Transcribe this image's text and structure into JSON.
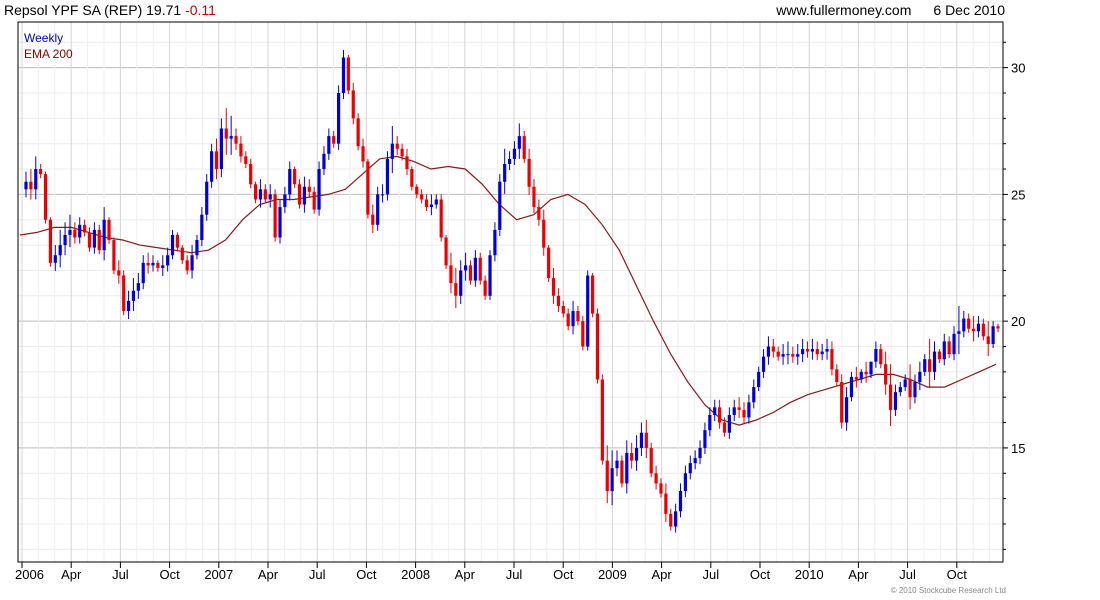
{
  "header": {
    "name": "Repsol YPF SA (REP)",
    "price": "19.71",
    "change": "-0.11",
    "site": "www.fullermoney.com",
    "date": "6 Dec 2010"
  },
  "legend": {
    "series1": "Weekly",
    "series2": "EMA 200"
  },
  "copyright": "© 2010 Stockcube Research Ltd",
  "colors": {
    "up": "#0000dd",
    "down": "#ee0000",
    "ema": "#8b1a1a",
    "grid": "#d8d8d8",
    "frame": "#000000"
  },
  "chart_data": {
    "type": "candlestick",
    "frequency": "weekly",
    "x_tick_labels": [
      "2006",
      "Apr",
      "Jul",
      "Oct",
      "2007",
      "Apr",
      "Jul",
      "Oct",
      "2008",
      "Apr",
      "Jul",
      "Oct",
      "2009",
      "Apr",
      "Jul",
      "Oct",
      "2010",
      "Apr",
      "Jul",
      "Oct"
    ],
    "y_tick_labels": [
      "15",
      "20",
      "25",
      "30"
    ],
    "ylim": [
      10.5,
      31.8
    ],
    "xlim": [
      "2006-01",
      "2010-12"
    ],
    "grid": true,
    "y_axis_side": "right",
    "legend_position": "top-left",
    "series": [
      {
        "name": "Weekly",
        "kind": "candlestick",
        "close": [
          25.5,
          25.2,
          26.0,
          25.8,
          24.0,
          22.3,
          22.6,
          23.0,
          23.4,
          23.6,
          23.3,
          23.8,
          23.5,
          22.9,
          23.6,
          22.8,
          24.0,
          23.2,
          22.0,
          21.8,
          20.4,
          20.8,
          21.2,
          21.5,
          22.3,
          22.2,
          22.3,
          22.1,
          22.2,
          22.6,
          23.4,
          22.9,
          22.4,
          22.0,
          22.6,
          23.2,
          24.2,
          25.5,
          26.7,
          26.0,
          27.6,
          27.2,
          27.3,
          27.0,
          26.5,
          26.2,
          25.4,
          24.8,
          25.2,
          24.8,
          25.0,
          23.3,
          24.5,
          25.0,
          26.0,
          25.4,
          24.6,
          25.3,
          25.1,
          24.4,
          26.0,
          26.6,
          27.3,
          27.0,
          29.0,
          30.4,
          29.1,
          28.0,
          26.9,
          26.3,
          24.2,
          23.8,
          25.0,
          25.0,
          26.4,
          27.0,
          26.8,
          26.5,
          26.0,
          25.3,
          25.0,
          24.8,
          24.5,
          24.6,
          24.8,
          23.3,
          22.2,
          21.5,
          21.0,
          22.0,
          22.2,
          21.6,
          22.5,
          21.6,
          21.0,
          22.6,
          23.6,
          25.5,
          26.2,
          26.4,
          26.8,
          27.3,
          26.4,
          25.3,
          24.5,
          24.0,
          22.9,
          21.7,
          21.0,
          20.6,
          20.3,
          19.8,
          20.4,
          20.0,
          19.0,
          21.8,
          20.3,
          17.7,
          14.5,
          13.3,
          14.2,
          14.5,
          13.6,
          14.8,
          14.5,
          15.0,
          15.6,
          15.0,
          14.0,
          13.6,
          13.2,
          12.4,
          11.9,
          12.5,
          13.3,
          14.0,
          14.4,
          14.6,
          15.0,
          15.7,
          16.3,
          16.6,
          16.0,
          15.6,
          16.3,
          16.6,
          16.5,
          16.2,
          16.8,
          17.4,
          18.0,
          18.6,
          19.0,
          18.8,
          18.6,
          18.7,
          18.7,
          18.6,
          18.7,
          18.9,
          18.8,
          18.9,
          18.7,
          18.8,
          18.9,
          18.1,
          17.6,
          16.0,
          17.0,
          17.8,
          17.7,
          18.0,
          17.9,
          18.4,
          18.9,
          18.3,
          17.5,
          16.5,
          17.2,
          17.4,
          17.7,
          17.0,
          17.6,
          18.0,
          18.5,
          18.0,
          18.8,
          18.5,
          19.2,
          18.7,
          19.5,
          19.6,
          20.1,
          19.7,
          19.6,
          19.9,
          19.4,
          19.1,
          19.8,
          19.71
        ],
        "high": [
          25.9,
          26.0,
          26.5,
          26.2,
          25.9,
          24.1,
          23.0,
          23.6,
          23.9,
          24.2,
          23.9,
          24.1,
          24.0,
          23.7,
          23.9,
          23.8,
          24.5,
          24.1,
          23.3,
          22.4,
          22.0,
          21.2,
          21.7,
          21.9,
          22.6,
          22.7,
          22.6,
          22.4,
          22.6,
          22.9,
          23.6,
          23.5,
          23.0,
          22.6,
          23.0,
          23.4,
          24.5,
          25.8,
          27.0,
          27.2,
          28.0,
          28.4,
          28.1,
          27.6,
          27.3,
          26.7,
          26.4,
          25.5,
          25.6,
          25.4,
          25.4,
          25.2,
          24.8,
          25.3,
          26.3,
          26.1,
          25.6,
          25.7,
          25.6,
          25.3,
          26.3,
          26.9,
          27.6,
          27.5,
          29.3,
          30.7,
          30.5,
          29.4,
          28.2,
          27.2,
          26.4,
          24.6,
          25.3,
          25.4,
          26.7,
          27.7,
          27.3,
          27.0,
          26.8,
          26.1,
          25.4,
          25.2,
          25.0,
          25.0,
          25.0,
          25.0,
          23.4,
          22.7,
          22.1,
          22.4,
          22.7,
          22.4,
          22.8,
          22.7,
          21.8,
          22.8,
          23.9,
          25.8,
          26.8,
          26.7,
          27.1,
          27.8,
          27.5,
          26.8,
          25.6,
          24.8,
          24.4,
          23.0,
          22.1,
          21.3,
          20.8,
          20.5,
          20.8,
          20.6,
          20.2,
          22.0,
          21.9,
          20.5,
          17.9,
          15.1,
          14.9,
          14.9,
          14.7,
          15.3,
          15.2,
          15.5,
          16.0,
          16.1,
          15.2,
          14.3,
          13.8,
          13.6,
          12.6,
          12.8,
          13.6,
          14.3,
          14.7,
          14.9,
          15.3,
          16.0,
          16.6,
          16.9,
          16.9,
          16.2,
          16.6,
          16.9,
          17.0,
          16.8,
          17.1,
          17.7,
          18.2,
          18.9,
          19.4,
          19.3,
          19.0,
          19.1,
          19.2,
          19.0,
          19.1,
          19.3,
          19.2,
          19.3,
          19.2,
          19.1,
          19.3,
          19.2,
          18.3,
          17.9,
          17.4,
          18.0,
          18.2,
          18.1,
          18.4,
          18.3,
          19.2,
          19.1,
          18.8,
          18.3,
          17.5,
          17.6,
          17.9,
          18.3,
          17.9,
          18.4,
          18.7,
          19.3,
          19.2,
          18.9,
          19.5,
          19.4,
          19.8,
          20.6,
          20.4,
          20.3,
          20.2,
          20.2,
          20.1,
          20.0,
          20.0,
          19.9
        ]
      },
      {
        "name": "EMA 200",
        "kind": "line",
        "values": [
          23.4,
          23.5,
          23.7,
          23.7,
          23.5,
          23.3,
          23.2,
          23.0,
          22.9,
          22.8,
          22.7,
          22.8,
          23.2,
          24.0,
          24.6,
          24.8,
          24.8,
          24.9,
          25.0,
          25.2,
          25.8,
          26.4,
          26.5,
          26.3,
          26.0,
          26.1,
          26.0,
          25.4,
          24.6,
          24.0,
          24.2,
          24.8,
          25.0,
          24.6,
          23.8,
          22.8,
          21.4,
          20.0,
          18.7,
          17.6,
          16.7,
          16.1,
          15.9,
          16.1,
          16.4,
          16.8,
          17.1,
          17.3,
          17.5,
          17.7,
          17.9,
          17.9,
          17.7,
          17.4,
          17.4,
          17.7,
          18.0,
          18.3
        ]
      }
    ]
  }
}
